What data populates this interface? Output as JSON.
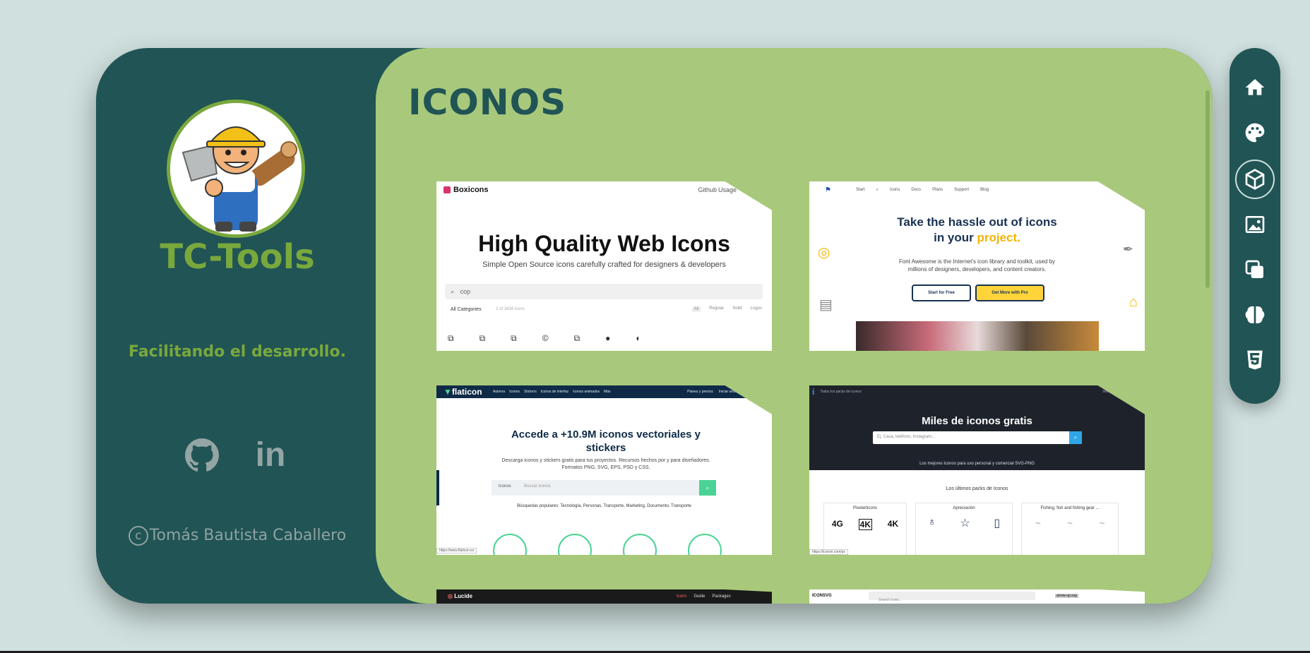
{
  "sidebar": {
    "brand": "TC-Tools",
    "tagline": "Facilitando el desarrollo.",
    "footer": "Tomás Bautista Caballero",
    "social": [
      "github-icon",
      "linkedin-icon"
    ]
  },
  "main": {
    "title": "ICONOS",
    "cards": [
      {
        "logo": "Boxicons",
        "nav": [
          "Github",
          "Usage"
        ],
        "headline": "High Quality Web Icons",
        "subtitle": "Simple Open Source icons carefully crafted for designers & developers",
        "search_value": "cop",
        "filter": "All Categories",
        "count": "2 of 1634 icons",
        "tabs": [
          "All",
          "Regular",
          "Solid",
          "Logos"
        ]
      },
      {
        "nav": [
          "Start",
          "Icons",
          "Docs",
          "Plans",
          "Support",
          "Blog"
        ],
        "headline": "Take the hassle out of icons",
        "headline2": "in your",
        "highlight": "project.",
        "body": "Font Awesome is the Internet's icon library and toolkit, used by millions of designers, developers, and content creators.",
        "btn_free": "Start for Free",
        "btn_pro": "Get More with Pro"
      },
      {
        "logo": "flaticon",
        "nav": [
          "Autores",
          "Iconos",
          "Stickers",
          "Iconos de interfaz",
          "Iconos animados",
          "Más"
        ],
        "nav_right": [
          "Planes y precios",
          "Iniciar sesión"
        ],
        "headline": "Accede a +10.9M iconos vectoriales y stickers",
        "body": "Descarga iconos y stickers gratis para tus proyectos. Recursos hechos por y para diseñadores. Formatos PNG, SVG, EPS, PSD y CSS.",
        "select": "Iconos",
        "placeholder": "Buscar iconos",
        "popular": "Búsquedas populares: Tecnología, Personas, Transporte, Marketing, Documento, Transporte",
        "status": "https://www.flaticon.es"
      },
      {
        "logo": "Todos los packs de iconos",
        "nav_right": "Inicia",
        "headline": "Miles de iconos gratis",
        "placeholder": "Ej: Casa, teléfono, instagram...",
        "tagline": "Los mejores iconos para uso personal y comercial SVG-PNG",
        "section": "Los últimos packs de Iconos",
        "packs": [
          "Pixelarticons",
          "Apreciación",
          "Fishing, fish and fishing gear ..."
        ],
        "pack_sample": [
          "4G",
          "4K",
          "4K"
        ],
        "status": "https://iconoir.com/ps"
      },
      {
        "logo": "Lucide",
        "nav": [
          "Icons",
          "Guide",
          "Packages"
        ]
      },
      {
        "logo": "ICONSVG",
        "placeholder": "Search icons...",
        "chip": "arrow-up.svg"
      }
    ]
  },
  "sidenav": {
    "items": [
      "home-icon",
      "palette-icon",
      "cube-icon",
      "image-icon",
      "copy-icon",
      "brain-icon",
      "css3-icon"
    ],
    "active": 2
  },
  "colors": {
    "dark": "#215455",
    "green": "#79a83d",
    "content": "#a8c97b",
    "bg": "#cfe0de"
  }
}
